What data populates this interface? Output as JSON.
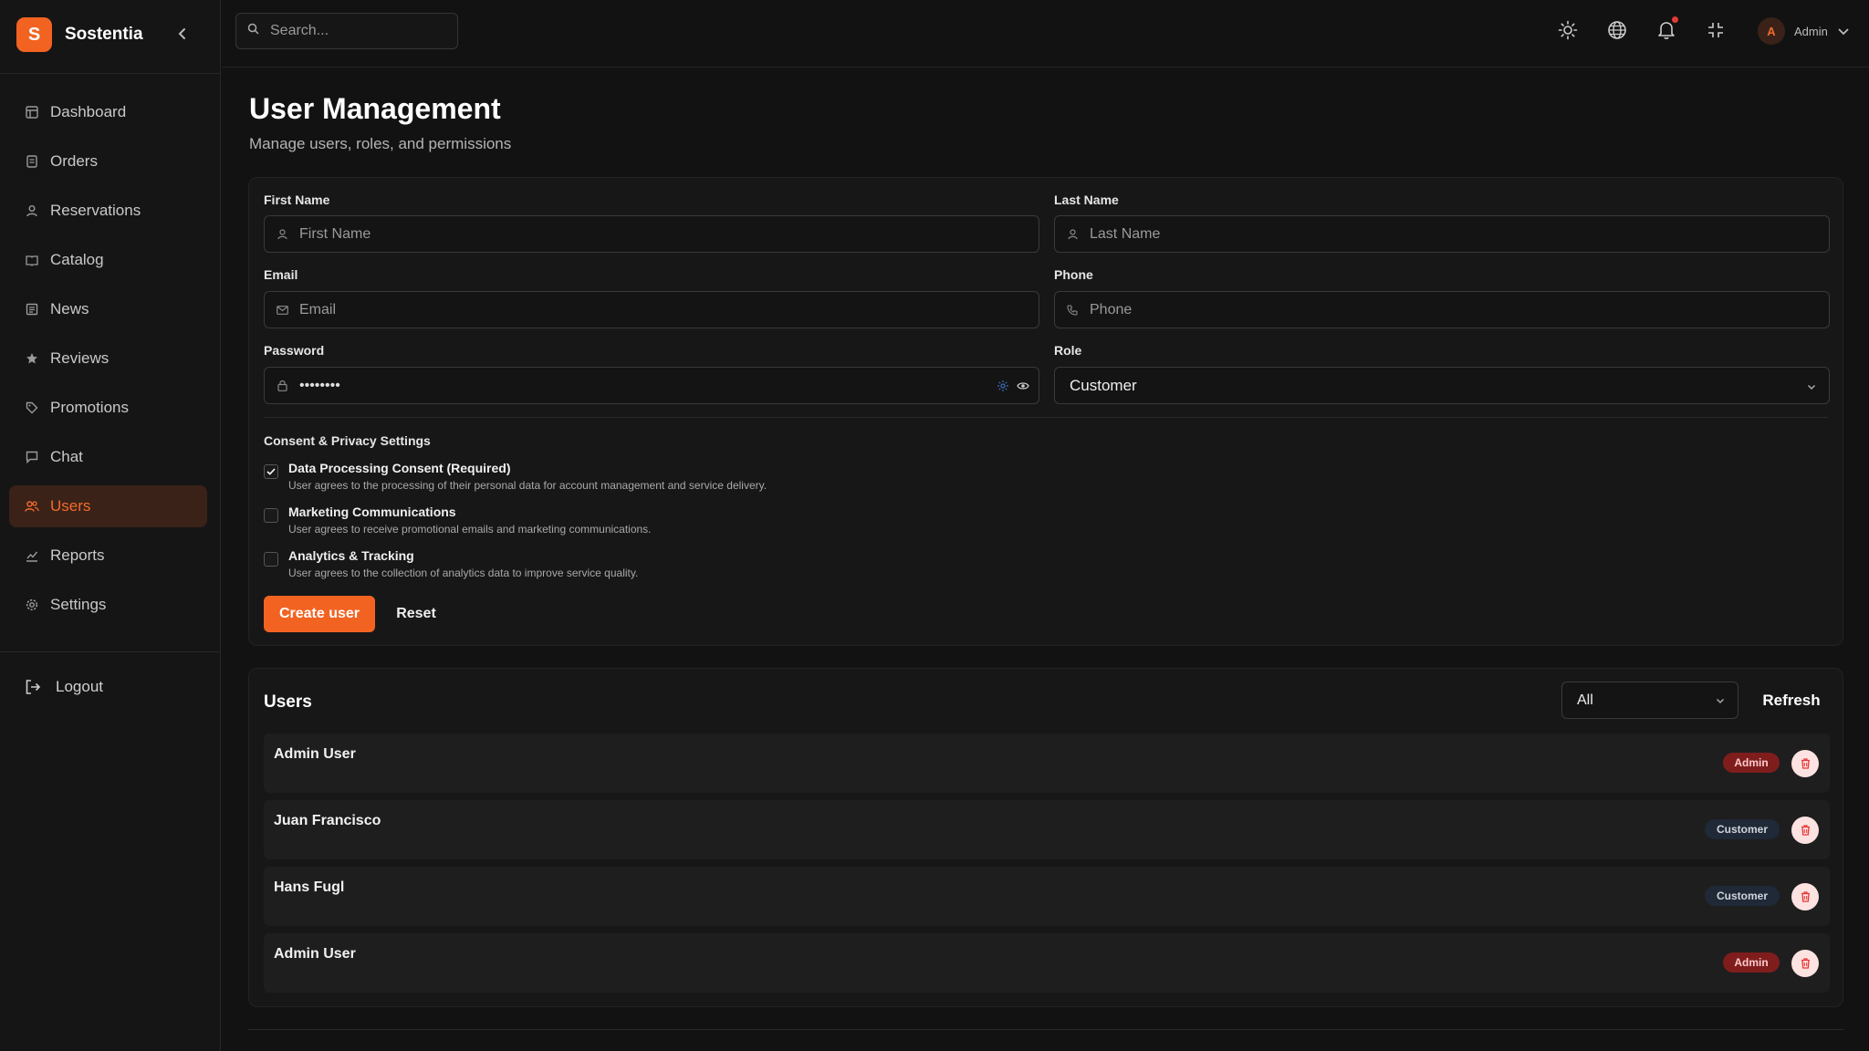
{
  "brand": {
    "logo_letter": "S",
    "name": "Sostentia",
    "accent": "#f26322"
  },
  "sidebar": {
    "items": [
      {
        "label": "Dashboard",
        "icon": "dashboard-icon"
      },
      {
        "label": "Orders",
        "icon": "orders-icon"
      },
      {
        "label": "Reservations",
        "icon": "reservations-icon"
      },
      {
        "label": "Catalog",
        "icon": "catalog-icon"
      },
      {
        "label": "News",
        "icon": "news-icon"
      },
      {
        "label": "Reviews",
        "icon": "star-icon"
      },
      {
        "label": "Promotions",
        "icon": "tag-icon"
      },
      {
        "label": "Chat",
        "icon": "chat-icon"
      },
      {
        "label": "Users",
        "icon": "users-icon",
        "active": true
      },
      {
        "label": "Reports",
        "icon": "reports-icon"
      },
      {
        "label": "Settings",
        "icon": "gear-icon"
      }
    ],
    "logout_label": "Logout"
  },
  "topbar": {
    "search_placeholder": "Search...",
    "user_initial": "A",
    "user_name": "Admin"
  },
  "page": {
    "title": "User Management",
    "subtitle": "Manage users, roles, and permissions"
  },
  "form": {
    "first_name": {
      "label": "First Name",
      "placeholder": "First Name"
    },
    "last_name": {
      "label": "Last Name",
      "placeholder": "Last Name"
    },
    "email": {
      "label": "Email",
      "placeholder": "Email"
    },
    "phone": {
      "label": "Phone",
      "placeholder": "Phone"
    },
    "password": {
      "label": "Password",
      "value": "••••••••"
    },
    "role": {
      "label": "Role",
      "selected": "Customer"
    },
    "consent_title": "Consent & Privacy Settings",
    "consents": [
      {
        "title": "Data Processing Consent (Required)",
        "desc": "User agrees to the processing of their personal data for account management and service delivery.",
        "checked": true
      },
      {
        "title": "Marketing Communications",
        "desc": "User agrees to receive promotional emails and marketing communications.",
        "checked": false
      },
      {
        "title": "Analytics & Tracking",
        "desc": "User agrees to the collection of analytics data to improve service quality.",
        "checked": false
      }
    ],
    "create_label": "Create user",
    "reset_label": "Reset"
  },
  "users": {
    "title": "Users",
    "filter_selected": "All",
    "refresh_label": "Refresh",
    "rows": [
      {
        "name": "Admin User",
        "role": "Admin"
      },
      {
        "name": "Juan Francisco",
        "role": "Customer"
      },
      {
        "name": "Hans Fugl",
        "role": "Customer"
      },
      {
        "name": "Admin User",
        "role": "Admin"
      }
    ]
  }
}
